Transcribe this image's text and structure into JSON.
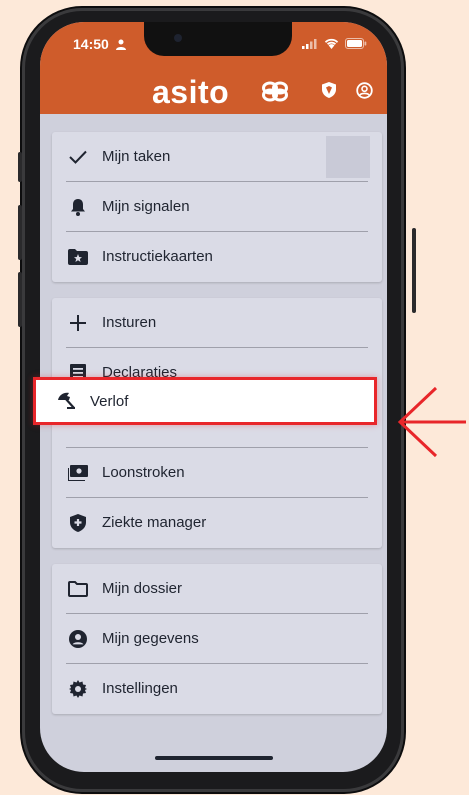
{
  "status_bar": {
    "time": "14:50"
  },
  "header": {
    "logo_text": "asito",
    "bg_color": "#cf5c2b"
  },
  "menu_groups": [
    {
      "items": [
        {
          "icon": "check-icon",
          "label": "Mijn taken"
        },
        {
          "icon": "bell-icon",
          "label": "Mijn signalen"
        },
        {
          "icon": "folder-star-icon",
          "label": "Instructiekaarten"
        }
      ]
    },
    {
      "items": [
        {
          "icon": "plus-icon",
          "label": "Insturen"
        },
        {
          "icon": "receipt-icon",
          "label": "Declaraties"
        },
        {
          "icon": "beach-umbrella-icon",
          "label": "Verlof",
          "highlighted": true
        },
        {
          "icon": "payment-icon",
          "label": "Loonstroken"
        },
        {
          "icon": "health-shield-icon",
          "label": "Ziekte manager"
        }
      ]
    },
    {
      "items": [
        {
          "icon": "folder-icon",
          "label": "Mijn dossier"
        },
        {
          "icon": "account-circle-icon",
          "label": "Mijn gegevens"
        },
        {
          "icon": "gear-icon",
          "label": "Instellingen"
        }
      ]
    }
  ],
  "annotation": {
    "highlight_color": "#e8262a",
    "arrow_color": "#e8262a"
  }
}
